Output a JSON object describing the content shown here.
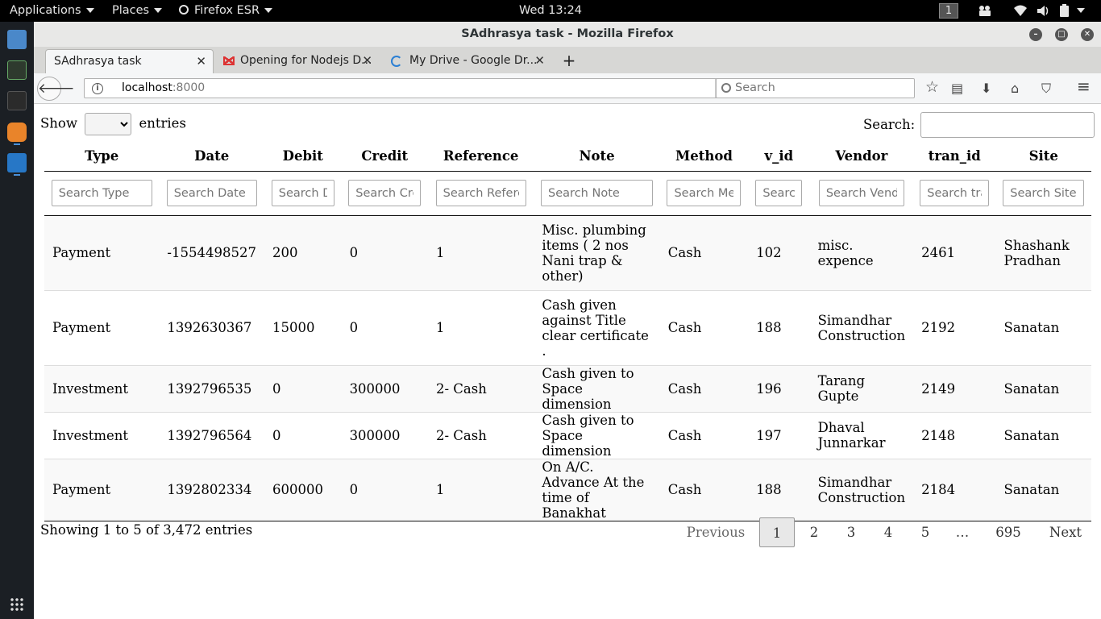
{
  "topbar": {
    "applications": "Applications",
    "places": "Places",
    "firefox": "Firefox ESR",
    "clock": "Wed 13:24",
    "workspace": "1"
  },
  "window": {
    "title": "SAdhrasya task - Mozilla Firefox"
  },
  "tabs": [
    {
      "label": "SAdhrasya task",
      "icon": "none"
    },
    {
      "label": "Opening for Nodejs D...",
      "icon": "gmail-icon"
    },
    {
      "label": "My Drive - Google Dr...",
      "icon": "loading-icon"
    }
  ],
  "nav": {
    "url_host": "localhost",
    "url_port": ":8000",
    "search_placeholder": "Search"
  },
  "datatable": {
    "show_label": "Show",
    "entries_label": "entries",
    "search_label": "Search:",
    "columns": [
      "Type",
      "Date",
      "Debit",
      "Credit",
      "Reference",
      "Note",
      "Method",
      "v_id",
      "Vendor",
      "tran_id",
      "Site"
    ],
    "filters": [
      "Search Type",
      "Search Date",
      "Search D",
      "Search Cre",
      "Search Referen",
      "Search Note",
      "Search Met",
      "Search",
      "Search Vendo",
      "Search tra",
      "Search Site"
    ],
    "rows": [
      [
        "Payment",
        "-1554498527",
        "200",
        "0",
        "1",
        "Misc. plumbing items ( 2 nos Nani trap & other)",
        "Cash",
        "102",
        "misc. expence",
        "2461",
        "Shashank Pradhan"
      ],
      [
        "Payment",
        "1392630367",
        "15000",
        "0",
        "1",
        "Cash given against Title clear certificate .",
        "Cash",
        "188",
        "Simandhar Construction",
        "2192",
        "Sanatan"
      ],
      [
        "Investment",
        "1392796535",
        "0",
        "300000",
        "2- Cash",
        "Cash given to Space dimension",
        "Cash",
        "196",
        "Tarang Gupte",
        "2149",
        "Sanatan"
      ],
      [
        "Investment",
        "1392796564",
        "0",
        "300000",
        "2- Cash",
        "Cash given to Space dimension",
        "Cash",
        "197",
        "Dhaval Junnarkar",
        "2148",
        "Sanatan"
      ],
      [
        "Payment",
        "1392802334",
        "600000",
        "0",
        "1",
        "On A/C. Advance At the time of Banakhat",
        "Cash",
        "188",
        "Simandhar Construction",
        "2184",
        "Sanatan"
      ]
    ],
    "info": "Showing 1 to 5 of 3,472 entries",
    "pagination": {
      "previous": "Previous",
      "pages": [
        "1",
        "2",
        "3",
        "4",
        "5",
        "…",
        "695"
      ],
      "next": "Next",
      "current": "1"
    }
  }
}
